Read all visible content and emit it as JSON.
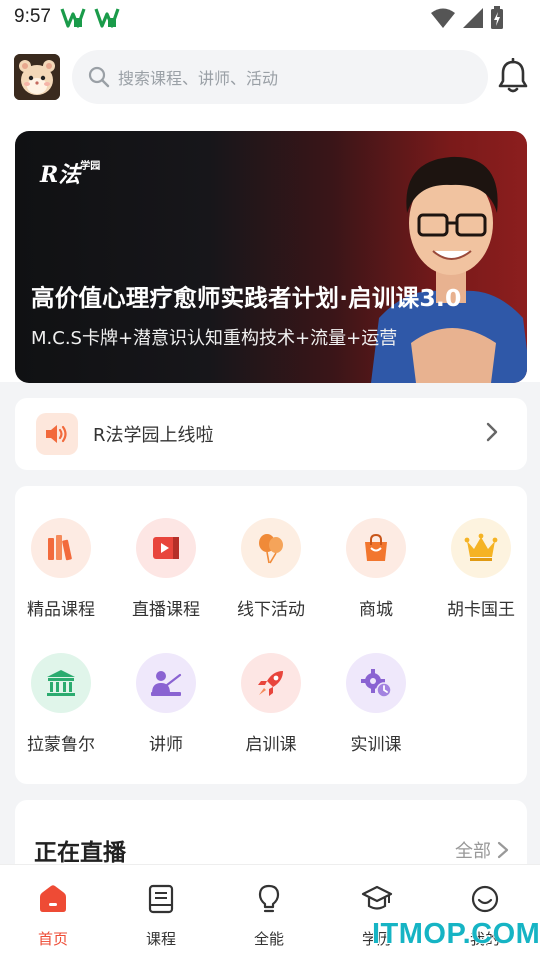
{
  "status_bar": {
    "time": "9:57"
  },
  "header": {
    "search_placeholder": "搜索课程、讲师、活动"
  },
  "banner": {
    "logo_text": "R法",
    "logo_small": "学园",
    "title": "高价值心理疗愈师实践者计划·启训课3.0",
    "subtitle": "M.C.S卡牌+潜意识认知重构技术+流量+运营"
  },
  "notice": {
    "text": "R法学园上线啦"
  },
  "categories": [
    {
      "label": "精品课程",
      "icon": "books-icon",
      "color": "#f26a3c",
      "bg": "#fdebe3"
    },
    {
      "label": "直播课程",
      "icon": "live-video-icon",
      "color": "#e8453c",
      "bg": "#fde6e4"
    },
    {
      "label": "线下活动",
      "icon": "balloons-icon",
      "color": "#f08a38",
      "bg": "#fdeee2"
    },
    {
      "label": "商城",
      "icon": "shopping-bag-icon",
      "color": "#f2762e",
      "bg": "#fdebe3"
    },
    {
      "label": "胡卡国王",
      "icon": "crown-icon",
      "color": "#f5b324",
      "bg": "#fdf3df"
    },
    {
      "label": "拉蒙鲁尔",
      "icon": "museum-icon",
      "color": "#2bab6f",
      "bg": "#e0f5ea"
    },
    {
      "label": "讲师",
      "icon": "teacher-icon",
      "color": "#8a63d2",
      "bg": "#efe8fb"
    },
    {
      "label": "启训课",
      "icon": "rocket-icon",
      "color": "#e8453c",
      "bg": "#fde6e4"
    },
    {
      "label": "实训课",
      "icon": "gear-clock-icon",
      "color": "#8a63d2",
      "bg": "#efe8fb"
    }
  ],
  "live_section": {
    "title": "正在直播",
    "all_label": "全部"
  },
  "tabbar": [
    {
      "label": "首页",
      "icon": "home-icon",
      "active": true
    },
    {
      "label": "课程",
      "icon": "course-book-icon",
      "active": false
    },
    {
      "label": "全能",
      "icon": "lightbulb-icon",
      "active": false
    },
    {
      "label": "学历",
      "icon": "graduation-cap-icon",
      "active": false
    },
    {
      "label": "我的",
      "icon": "profile-smile-icon",
      "active": false
    }
  ],
  "watermark": "ITMOP.COM",
  "colors": {
    "accent": "#ee4b35",
    "watermark": "#16b4c4"
  }
}
